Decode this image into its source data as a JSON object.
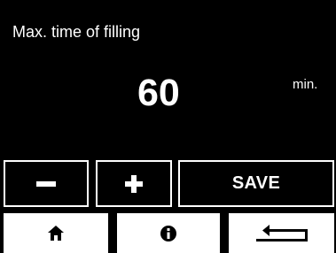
{
  "screen": {
    "title": "Max. time of filling",
    "value": "60",
    "unit": "min."
  },
  "controls": {
    "minus_icon": "minus-icon",
    "plus_icon": "plus-icon",
    "save_label": "SAVE"
  },
  "navbar": {
    "items": [
      {
        "icon": "home-icon"
      },
      {
        "icon": "info-icon"
      },
      {
        "icon": "return-arrow-icon"
      }
    ]
  },
  "colors": {
    "background": "#000000",
    "foreground": "#ffffff"
  }
}
